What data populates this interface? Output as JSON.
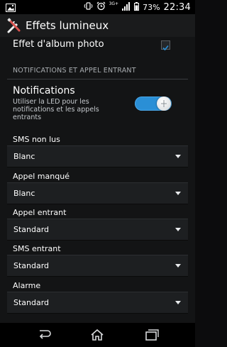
{
  "status_bar": {
    "network": "3G+",
    "battery_percent": "73%",
    "time": "22:34",
    "icons": [
      "image-notification-icon",
      "vibrate-icon",
      "alarm-icon",
      "signal-icon",
      "battery-icon"
    ]
  },
  "action_bar": {
    "title": "Effets lumineux",
    "icon": "tools-icon"
  },
  "album_effect": {
    "label": "Effet d'album photo",
    "checked": true
  },
  "section": {
    "header": "NOTIFICATIONS ET APPEL ENTRANT"
  },
  "notifications": {
    "title": "Notifications",
    "summary": "Utiliser la LED pour les notifications et les appels entrants",
    "enabled": true
  },
  "prefs": [
    {
      "label": "SMS non lus",
      "value": "Blanc"
    },
    {
      "label": "Appel manqué",
      "value": "Blanc"
    },
    {
      "label": "Appel entrant",
      "value": "Standard"
    },
    {
      "label": "SMS entrant",
      "value": "Standard"
    },
    {
      "label": "Alarme",
      "value": "Standard"
    }
  ],
  "colors": {
    "accent": "#2a8fd6",
    "background": "#131415"
  },
  "nav_bar": {
    "icons": [
      "back-icon",
      "home-icon",
      "recent-apps-icon"
    ]
  }
}
